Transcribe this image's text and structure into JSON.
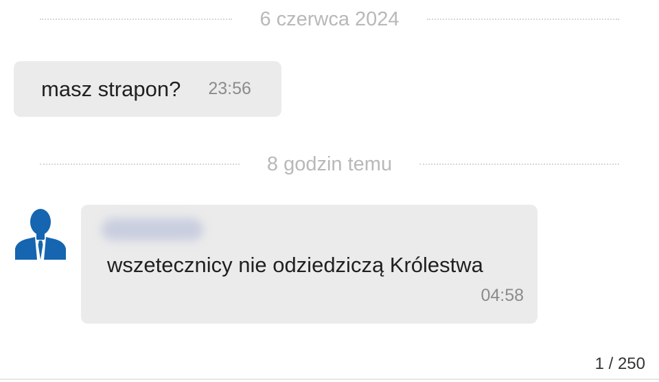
{
  "date_separators": [
    "6 czerwca 2024",
    "8 godzin temu"
  ],
  "messages": [
    {
      "text": "masz strapon?",
      "time": "23:56"
    },
    {
      "sender": "",
      "text": "wszetecznicy nie odziedziczą Królestwa",
      "time": "04:58"
    }
  ],
  "pagination": "1 / 250",
  "icons": {
    "avatar": "person-in-suit-avatar-icon"
  },
  "colors": {
    "bubble": "#ebebeb",
    "avatar": "#1565b0",
    "separator_text": "#b8b8b8"
  }
}
